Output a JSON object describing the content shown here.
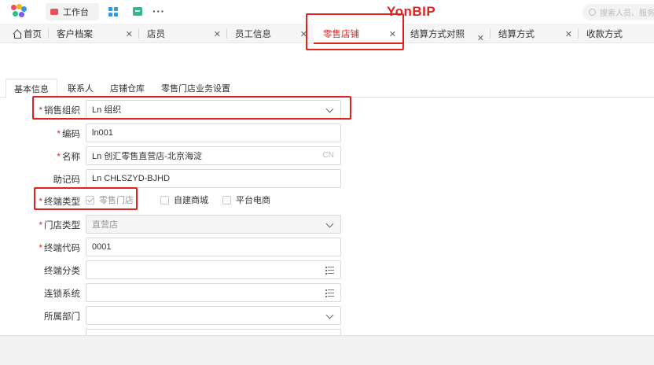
{
  "topbar": {
    "workbench_label": "工作台",
    "brand": "YonBIP",
    "search_placeholder": "搜索人员、服务"
  },
  "tabs": [
    {
      "label": "首页"
    },
    {
      "label": "客户档案"
    },
    {
      "label": "店员"
    },
    {
      "label": "员工信息"
    },
    {
      "label": "零售店铺"
    },
    {
      "label": "结算方式对照"
    },
    {
      "label": "结算方式"
    },
    {
      "label": "收款方式"
    }
  ],
  "subtabs": [
    "基本信息",
    "联系人",
    "店铺仓库",
    "零售门店业务设置"
  ],
  "form": {
    "sales_org": {
      "label": "销售组织",
      "value": "Ln 组织"
    },
    "code": {
      "label": "编码",
      "value": "ln001"
    },
    "name": {
      "label": "名称",
      "value": "Ln 创汇零售直营店-北京海淀",
      "suffix": "CN"
    },
    "mnemonic": {
      "label": "助记码",
      "value": "Ln CHLSZYD-BJHD"
    },
    "terminal_type": {
      "label": "终端类型",
      "options": [
        "零售门店",
        "自建商城",
        "平台电商"
      ]
    },
    "store_type": {
      "label": "门店类型",
      "value": "直营店"
    },
    "terminal_code": {
      "label": "终端代码",
      "value": "0001"
    },
    "terminal_category": {
      "label": "终端分类",
      "value": ""
    },
    "chain_system": {
      "label": "连锁系统",
      "value": ""
    },
    "department": {
      "label": "所属部门",
      "value": ""
    }
  },
  "colors": {
    "accent": "#e2211c",
    "brand": "#e2211c"
  }
}
